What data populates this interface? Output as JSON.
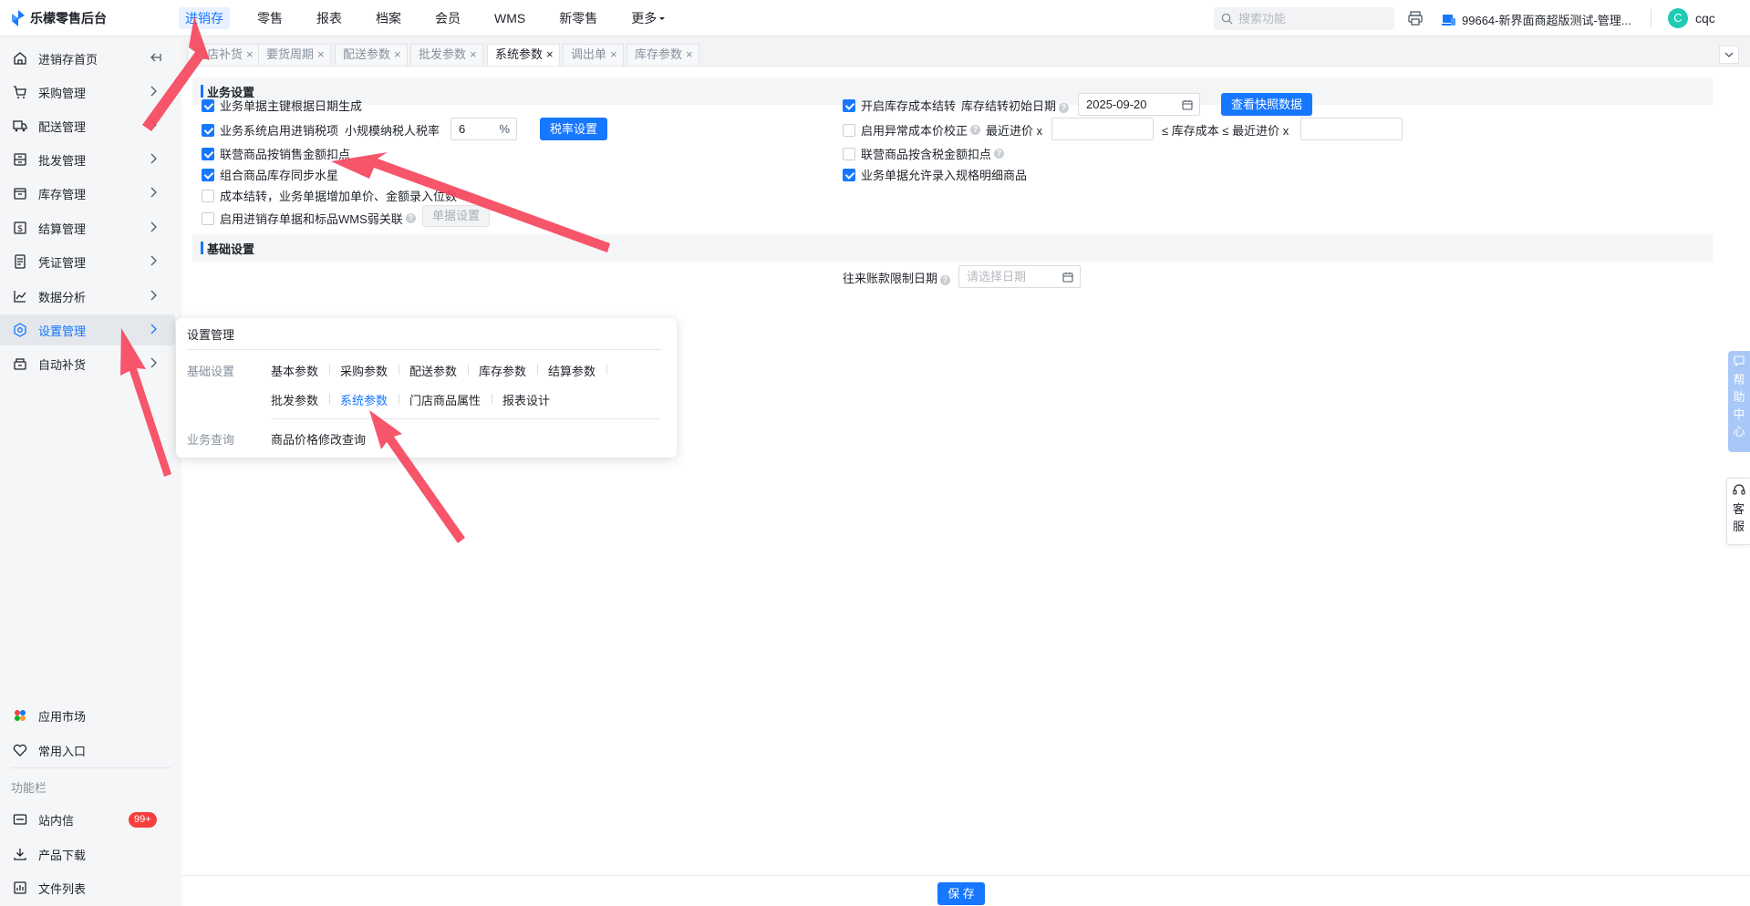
{
  "app": {
    "title": "乐檬零售后台"
  },
  "nav": {
    "items": [
      "进销存",
      "零售",
      "报表",
      "档案",
      "会员",
      "WMS",
      "新零售",
      "更多"
    ]
  },
  "search": {
    "placeholder": "搜索功能"
  },
  "store": {
    "name": "99664-新界面商超版测试-管理..."
  },
  "user": {
    "initial": "C",
    "name": "cqc"
  },
  "sidebar": {
    "items": [
      {
        "label": "进销存首页",
        "icon": "home-icon"
      },
      {
        "label": "采购管理",
        "icon": "cart-icon"
      },
      {
        "label": "配送管理",
        "icon": "truck-icon"
      },
      {
        "label": "批发管理",
        "icon": "wholesale-icon"
      },
      {
        "label": "库存管理",
        "icon": "inventory-icon"
      },
      {
        "label": "结算管理",
        "icon": "settlement-icon"
      },
      {
        "label": "凭证管理",
        "icon": "voucher-icon"
      },
      {
        "label": "数据分析",
        "icon": "chart-icon"
      },
      {
        "label": "设置管理",
        "icon": "gear-icon"
      },
      {
        "label": "自动补货",
        "icon": "replenish-icon"
      }
    ],
    "bottom": [
      {
        "label": "应用市场",
        "icon": "app-market-icon"
      },
      {
        "label": "常用入口",
        "icon": "heart-icon"
      }
    ],
    "func_label": "功能栏",
    "func": [
      {
        "label": "站内信",
        "icon": "mail-icon",
        "badge": "99+"
      },
      {
        "label": "产品下载",
        "icon": "download-icon"
      },
      {
        "label": "文件列表",
        "icon": "file-list-icon"
      }
    ]
  },
  "tabs": [
    {
      "label": "门店补货"
    },
    {
      "label": "要货周期"
    },
    {
      "label": "配送参数"
    },
    {
      "label": "批发参数"
    },
    {
      "label": "系统参数"
    },
    {
      "label": "调出单"
    },
    {
      "label": "库存参数"
    }
  ],
  "business": {
    "title": "业务设置",
    "left": {
      "opt1": "业务单据主键根据日期生成",
      "opt2": "业务系统启用进销税项",
      "tax_label": "小规模纳税人税率",
      "tax_value": "6",
      "tax_unit": "%",
      "tax_btn": "税率设置",
      "opt3": "联营商品按销售金额扣点",
      "opt4": "组合商品库存同步水星",
      "opt5": "成本结转，业务单据增加单价、金额录入位数",
      "opt6": "启用进销存单据和标品WMS弱关联",
      "doc_btn": "单据设置"
    },
    "right": {
      "opt1": "开启库存成本结转",
      "date_label": "库存结转初始日期",
      "date_value": "2025-09-20",
      "snapshot_btn": "查看快照数据",
      "opt2": "启用异常成本价校正",
      "recent_label": "最近进价 x",
      "le_label": "≤ 库存成本 ≤ 最近进价 x",
      "opt3": "联营商品按含税金额扣点",
      "opt4": "业务单据允许录入规格明细商品"
    }
  },
  "basic": {
    "title": "基础设置",
    "limit_label": "往来账款限制日期",
    "limit_placeholder": "请选择日期"
  },
  "popup": {
    "title": "设置管理",
    "group1": "基础设置",
    "links1": [
      "基本参数",
      "采购参数",
      "配送参数",
      "库存参数",
      "结算参数"
    ],
    "links2": [
      "批发参数",
      "系统参数",
      "门店商品属性",
      "报表设计"
    ],
    "group2": "业务查询",
    "links3": [
      "商品价格修改查询"
    ]
  },
  "help": {
    "chars": [
      "帮",
      "助",
      "中",
      "心"
    ]
  },
  "service": {
    "chars": [
      "客",
      "服"
    ]
  },
  "footer": {
    "save": "保 存"
  },
  "colors": {
    "accent": "#1677ff",
    "arrow": "#f5475d",
    "badge": "#f53f3f"
  }
}
